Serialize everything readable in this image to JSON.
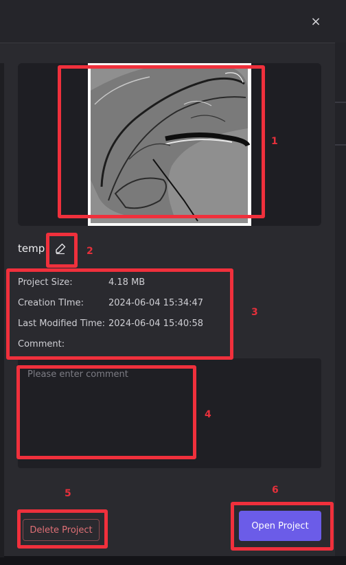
{
  "dialog": {
    "close_label": "×"
  },
  "project": {
    "name": "temp"
  },
  "info": [
    {
      "key": "Project Size:",
      "value": "4.18 MB"
    },
    {
      "key": "Creation TIme:",
      "value": "2024-06-04 15:34:47"
    },
    {
      "key": "Last Modified Time:",
      "value": "2024-06-04 15:40:58"
    },
    {
      "key": "Comment:",
      "value": ""
    }
  ],
  "comment": {
    "placeholder": "Please enter comment",
    "value": ""
  },
  "buttons": {
    "delete_label": "Delete Project",
    "open_label": "Open Project"
  },
  "annotations": [
    "1",
    "2",
    "3",
    "4",
    "5",
    "6"
  ],
  "icons": {
    "close": "close-icon",
    "edit": "pencil-edit-icon"
  },
  "colors": {
    "accent": "#6b5ce8",
    "danger": "#e07076",
    "annotation": "#f0303c"
  }
}
